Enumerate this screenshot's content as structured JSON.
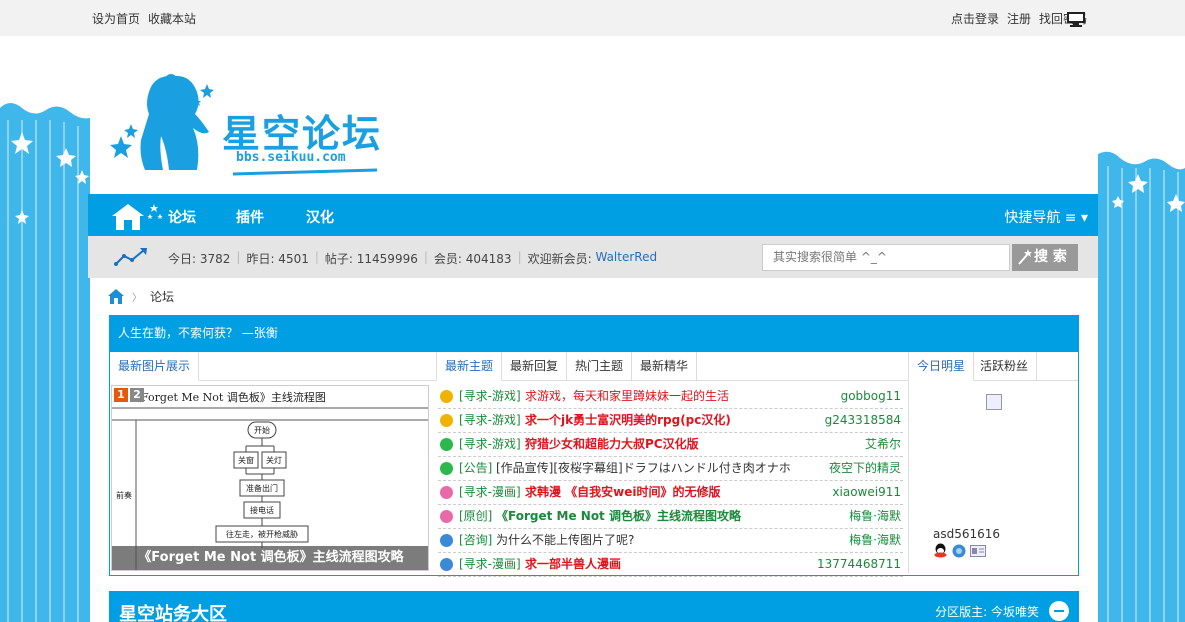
{
  "topbar": {
    "set_home": "设为首页",
    "bookmark": "收藏本站",
    "login": "点击登录",
    "register": "注册",
    "recover": "找回密码"
  },
  "logo": {
    "title": "星空论坛",
    "subtitle": "bbs.seikuu.com"
  },
  "nav": {
    "items": [
      {
        "label": "论坛"
      },
      {
        "label": "插件"
      },
      {
        "label": "汉化"
      }
    ],
    "quick_nav": "快捷导航 ≡ ▾"
  },
  "stats": {
    "today": "今日: 3782",
    "yesterday": "昨日: 4501",
    "posts": "帖子: 11459996",
    "members": "会员: 404183",
    "welcome_prefix": "欢迎新会员: ",
    "new_member": "WalterRed"
  },
  "search": {
    "placeholder": "其实搜索很简单 ^_^",
    "button": "搜 索"
  },
  "breadcrumb": {
    "current": "论坛"
  },
  "motto": "人生在勤，不索何获？ —张衡",
  "image_panel": {
    "tab": "最新图片展示",
    "doc_title": "《Forget Me Not 调色板》主线流程图",
    "caption": "《Forget Me Not 调色板》主线流程图攻略",
    "num1": "1",
    "num2": "2",
    "flow": [
      "开始",
      "关窗",
      "关灯",
      "准备出门",
      "接电话",
      "往左走，被开枪威胁"
    ],
    "side_label": "前奏"
  },
  "thread_tabs": [
    {
      "label": "最新主题"
    },
    {
      "label": "最新回复"
    },
    {
      "label": "热门主题"
    },
    {
      "label": "最新精华"
    }
  ],
  "threads": [
    {
      "cat": "[寻求-游戏]",
      "title": "求游戏，每天和家里蹲妹妹一起的生活",
      "author": "gobbog11",
      "color": "#e0141e",
      "icon_color": "#f0b400",
      "bold": false
    },
    {
      "cat": "[寻求-游戏]",
      "title": "求一个jk勇士富沢明美的rpg(pc汉化)",
      "author": "g243318584",
      "color": "#e0141e",
      "icon_color": "#f0b400",
      "bold": true
    },
    {
      "cat": "[寻求-游戏]",
      "title": "狩猎少女和超能力大叔PC汉化版",
      "author": "艾希尔",
      "color": "#e0141e",
      "icon_color": "#2cb84c",
      "bold": true
    },
    {
      "cat": "[公告]",
      "title": "[作品宣传][夜桜字幕组]ドラフはハンドル付き肉オナホ",
      "author": "夜空下的精灵",
      "color": "#333333",
      "icon_color": "#2cb84c",
      "bold": false
    },
    {
      "cat": "[寻求-漫画]",
      "title": "求韩漫 《自我安wei时间》的无修版",
      "author": "xiaowei911",
      "color": "#e0141e",
      "icon_color": "#e86aa8",
      "bold": true
    },
    {
      "cat": "[原创]",
      "title": "《Forget Me Not 调色板》主线流程图攻略",
      "author": "梅鲁·海默",
      "color": "#1a8a3a",
      "icon_color": "#e86aa8",
      "bold": true
    },
    {
      "cat": "[咨询]",
      "title": "为什么不能上传图片了呢?",
      "author": "梅鲁·海默",
      "color": "#333333",
      "icon_color": "#3a8ad8",
      "bold": false
    },
    {
      "cat": "[寻求-漫画]",
      "title": "求一部半兽人漫画",
      "author": "13774468711",
      "color": "#e0141e",
      "icon_color": "#3a8ad8",
      "bold": true
    }
  ],
  "star_tabs": [
    {
      "label": "今日明星"
    },
    {
      "label": "活跃粉丝"
    }
  ],
  "star": {
    "name": "asd561616"
  },
  "section": {
    "title": "星空站务大区",
    "moderator": "分区版主: 今坂唯笑"
  },
  "colors": {
    "brand": "#009fe3",
    "link": "#2a6db5",
    "category": "#1a8a3a",
    "hot": "#e0141e"
  }
}
